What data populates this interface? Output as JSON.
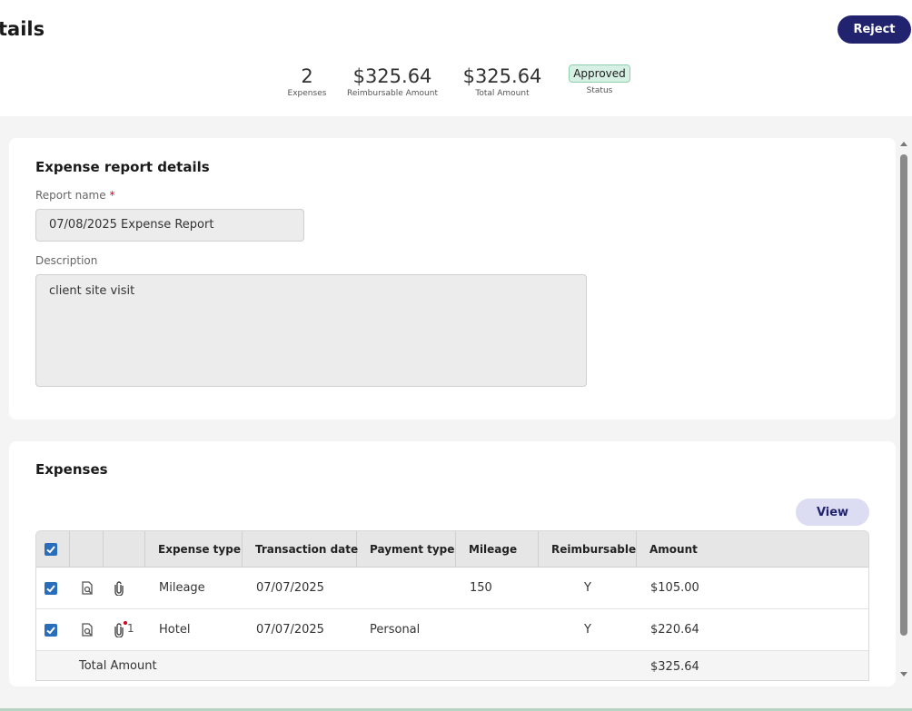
{
  "header": {
    "title_fragment": "tails",
    "reject_label": "Reject"
  },
  "summary": {
    "expenses_count": "2",
    "expenses_label": "Expenses",
    "reimbursable_amount": "$325.64",
    "reimbursable_label": "Reimbursable Amount",
    "total_amount": "$325.64",
    "total_label": "Total Amount",
    "status_value": "Approved",
    "status_label": "Status"
  },
  "details": {
    "title": "Expense report details",
    "report_name_label": "Report name",
    "required_marker": "*",
    "report_name_value": "07/08/2025 Expense Report",
    "description_label": "Description",
    "description_value": "client site visit"
  },
  "expenses": {
    "title": "Expenses",
    "view_label": "View",
    "columns": [
      "Expense type",
      "Transaction date",
      "Payment type",
      "Mileage",
      "Reimbursable",
      "Amount"
    ],
    "rows": [
      {
        "expense_type": "Mileage",
        "transaction_date": "07/07/2025",
        "payment_type": "",
        "mileage": "150",
        "reimbursable": "Y",
        "amount": "$105.00",
        "attachment_count": "",
        "checked": true
      },
      {
        "expense_type": "Hotel",
        "transaction_date": "07/07/2025",
        "payment_type": "Personal",
        "mileage": "",
        "reimbursable": "Y",
        "amount": "$220.64",
        "attachment_count": "1",
        "checked": true
      }
    ],
    "total_label": "Total Amount",
    "total_value": "$325.64"
  },
  "icons": {
    "preview": "magnifier-receipt-icon",
    "attachment": "paperclip-icon",
    "checkbox": "checkmark-icon"
  },
  "colors": {
    "primary": "#22236e",
    "view_button_bg": "#dcdcf3",
    "status_bg": "#d6f0e3",
    "checkbox": "#2a6ebb",
    "required": "#d0021b"
  }
}
